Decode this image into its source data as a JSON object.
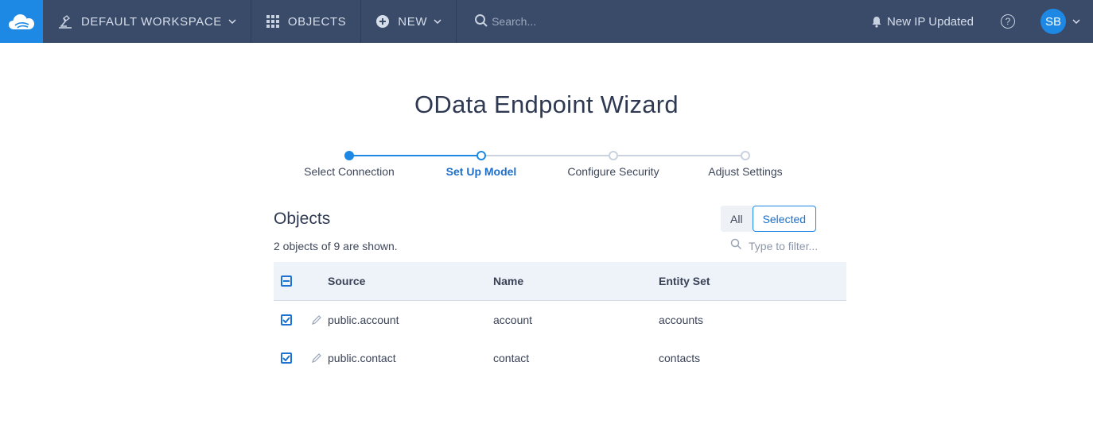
{
  "topbar": {
    "workspace_label": "DEFAULT WORKSPACE",
    "objects_label": "OBJECTS",
    "new_label": "NEW",
    "search_placeholder": "Search...",
    "notification_label": "New IP Updated",
    "help_label": "?",
    "avatar_initials": "SB"
  },
  "page": {
    "title": "OData Endpoint Wizard"
  },
  "steps": [
    {
      "label": "Select Connection",
      "state": "done"
    },
    {
      "label": "Set Up Model",
      "state": "active"
    },
    {
      "label": "Configure Security",
      "state": "pending"
    },
    {
      "label": "Adjust Settings",
      "state": "pending"
    }
  ],
  "objects": {
    "title": "Objects",
    "count_text": "2 objects of 9 are shown.",
    "toggle_all": "All",
    "toggle_selected": "Selected",
    "filter_placeholder": "Type to filter...",
    "columns": {
      "source": "Source",
      "name": "Name",
      "entity_set": "Entity Set"
    },
    "rows": [
      {
        "source": "public.account",
        "name": "account",
        "entity_set": "accounts",
        "checked": true
      },
      {
        "source": "public.contact",
        "name": "contact",
        "entity_set": "contacts",
        "checked": true
      }
    ]
  },
  "colors": {
    "topbar_bg": "#3a4a69",
    "accent": "#1e88e5",
    "header_row_bg": "#eef3fa"
  }
}
